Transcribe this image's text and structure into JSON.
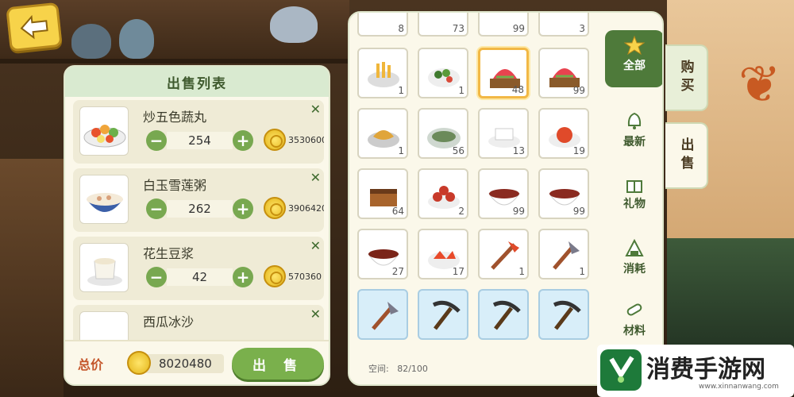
{
  "back_button": {
    "icon": "back-arrow-icon"
  },
  "sell_panel": {
    "title": "出售列表",
    "items": [
      {
        "name": "炒五色蔬丸",
        "qty": "254",
        "price": "3530600",
        "close": "✕"
      },
      {
        "name": "白玉雪莲粥",
        "qty": "262",
        "price": "3906420",
        "close": "✕"
      },
      {
        "name": "花生豆浆",
        "qty": "42",
        "price": "570360",
        "close": "✕"
      },
      {
        "name": "西瓜冰沙",
        "qty": "",
        "price": "",
        "close": "✕"
      }
    ],
    "total_label": "总价",
    "total_value": "8020480",
    "sell_button": "出 售"
  },
  "inventory": {
    "top_row_counts": [
      "8",
      "73",
      "99",
      "3"
    ],
    "cells": [
      {
        "count": "1",
        "icon": "fries-plate-icon"
      },
      {
        "count": "1",
        "icon": "salad-plate-icon"
      },
      {
        "count": "48",
        "icon": "watermelon-dessert-icon",
        "selected": true
      },
      {
        "count": "99",
        "icon": "watermelon-dessert-icon"
      },
      {
        "count": "1",
        "icon": "fried-dish-icon"
      },
      {
        "count": "56",
        "icon": "fish-soup-icon"
      },
      {
        "count": "13",
        "icon": "tofu-icon"
      },
      {
        "count": "19",
        "icon": "tomato-dish-icon"
      },
      {
        "count": "64",
        "icon": "cake-icon"
      },
      {
        "count": "2",
        "icon": "pastry-plate-icon"
      },
      {
        "count": "99",
        "icon": "bean-porridge-icon"
      },
      {
        "count": "99",
        "icon": "bean-porridge-icon"
      },
      {
        "count": "27",
        "icon": "bean-bowl-icon"
      },
      {
        "count": "17",
        "icon": "tomato-plate-icon"
      },
      {
        "count": "1",
        "icon": "hoe-icon"
      },
      {
        "count": "1",
        "icon": "axe-icon"
      },
      {
        "count": "",
        "icon": "axe-icon",
        "blue": true
      },
      {
        "count": "",
        "icon": "pickaxe-icon",
        "blue": true
      },
      {
        "count": "",
        "icon": "pickaxe-icon",
        "blue": true
      },
      {
        "count": "",
        "icon": "pickaxe-icon",
        "blue": true
      }
    ],
    "capacity_label": "空间:",
    "capacity_value": "82/100"
  },
  "categories": [
    {
      "label": "全部",
      "icon": "star-icon",
      "active": true
    },
    {
      "label": "最新",
      "icon": "bell-icon"
    },
    {
      "label": "礼物",
      "icon": "gift-icon"
    },
    {
      "label": "消耗",
      "icon": "rice-ball-icon"
    },
    {
      "label": "材料",
      "icon": "wood-icon"
    }
  ],
  "side_tabs": {
    "buy": "购买",
    "sell": "出售"
  },
  "watermark": {
    "text": "消费手游网",
    "url": "www.xinnanwang.com"
  },
  "colors": {
    "accent_green": "#7ab04c",
    "dark_green": "#4e7a3a",
    "coin_gold": "#e3b51a",
    "selected_border": "#f2b845"
  }
}
